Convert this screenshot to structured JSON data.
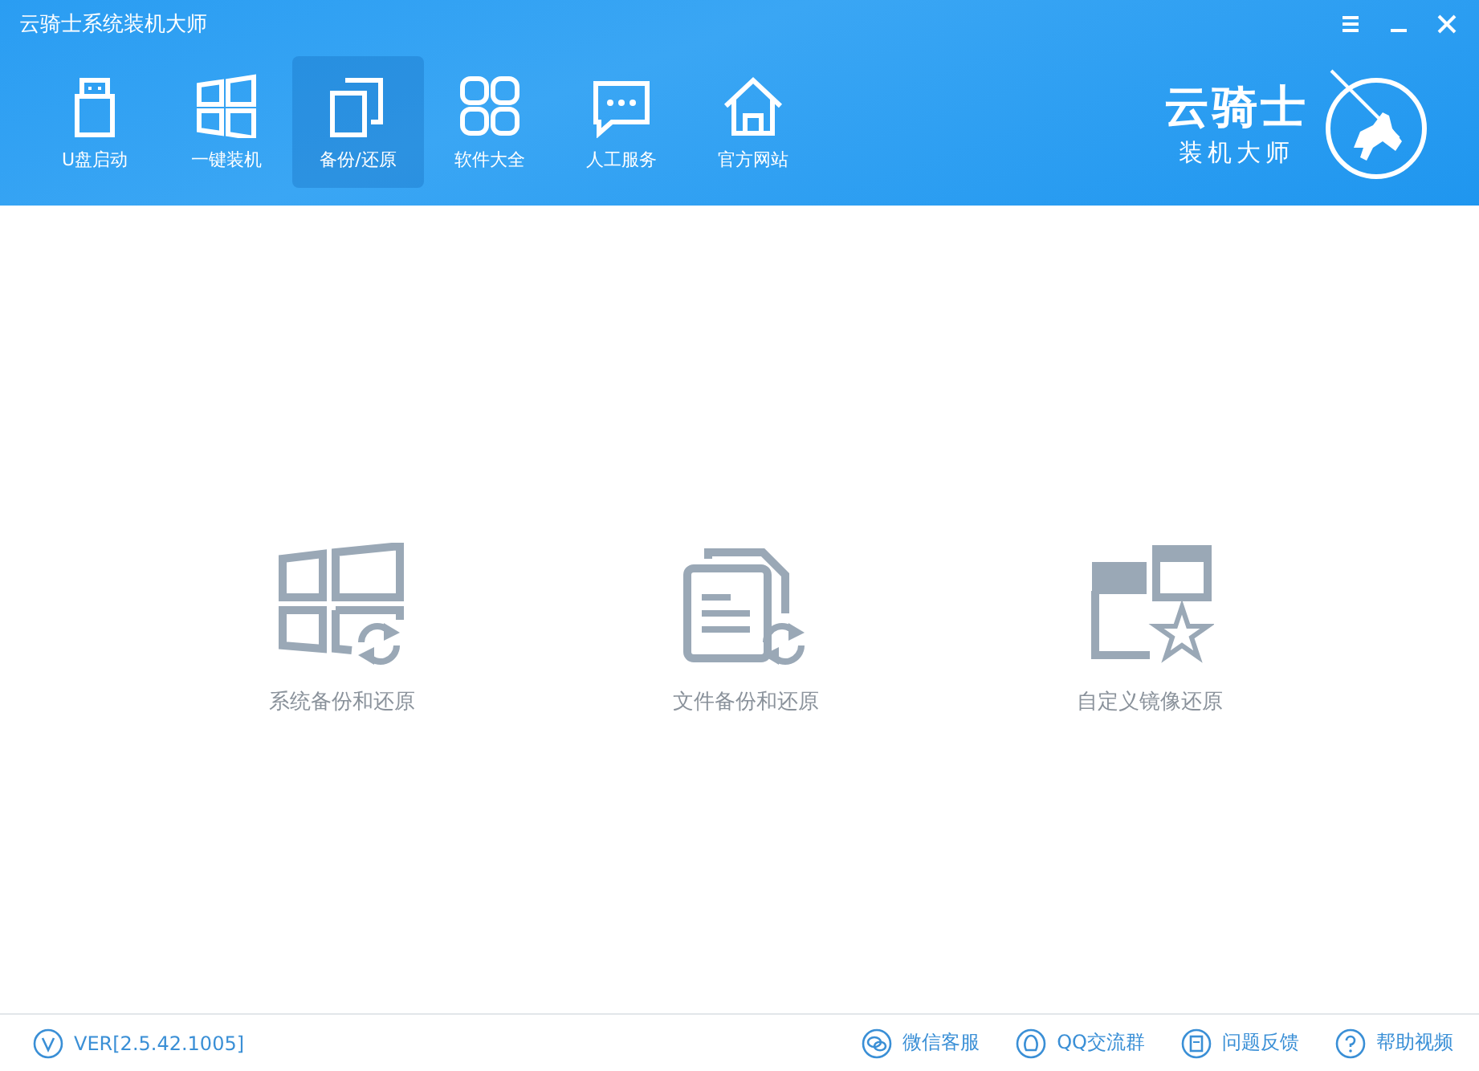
{
  "window": {
    "title": "云骑士系统装机大师"
  },
  "window_controls": [
    {
      "kind": "menu"
    },
    {
      "kind": "minimize"
    },
    {
      "kind": "close"
    }
  ],
  "nav": [
    {
      "kind": "usb",
      "label": "U盘启动",
      "selected": false
    },
    {
      "kind": "windows",
      "label": "一键装机",
      "selected": false
    },
    {
      "kind": "copy",
      "label": "备份/还原",
      "selected": true
    },
    {
      "kind": "grid",
      "label": "软件大全",
      "selected": false
    },
    {
      "kind": "chat",
      "label": "人工服务",
      "selected": false
    },
    {
      "kind": "home",
      "label": "官方网站",
      "selected": false
    }
  ],
  "logo": {
    "name": "云骑士",
    "subtitle": "装机大师"
  },
  "options": [
    {
      "kind": "system",
      "label": "系统备份和还原"
    },
    {
      "kind": "file",
      "label": "文件备份和还原"
    },
    {
      "kind": "image",
      "label": "自定义镜像还原"
    }
  ],
  "status_bar": {
    "version": "VER[2.5.42.1005]",
    "links": [
      {
        "kind": "wechat",
        "label": "微信客服"
      },
      {
        "kind": "qq",
        "label": "QQ交流群"
      },
      {
        "kind": "feedback",
        "label": "问题反馈"
      },
      {
        "kind": "help",
        "label": "帮助视频"
      }
    ]
  }
}
